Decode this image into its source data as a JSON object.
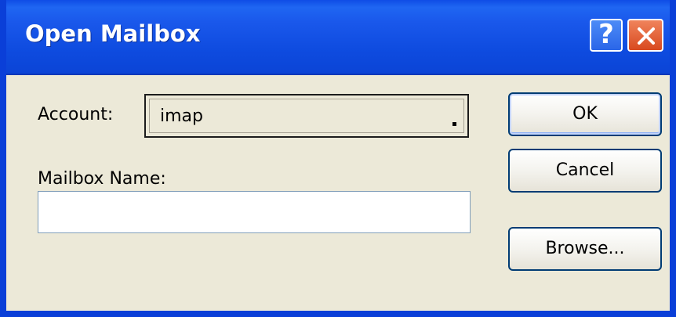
{
  "window": {
    "title": "Open Mailbox",
    "help_glyph": "?",
    "icons": {
      "help": "help-icon",
      "close": "close-icon"
    }
  },
  "form": {
    "account_label": "Account:",
    "account_value": "imap",
    "mailbox_label": "Mailbox Name:",
    "mailbox_value": ""
  },
  "buttons": {
    "ok": "OK",
    "cancel": "Cancel",
    "browse": "Browse..."
  },
  "colors": {
    "titlebar": "#0f4de6",
    "dialog_bg": "#ece9d8",
    "close": "#d8491f"
  }
}
